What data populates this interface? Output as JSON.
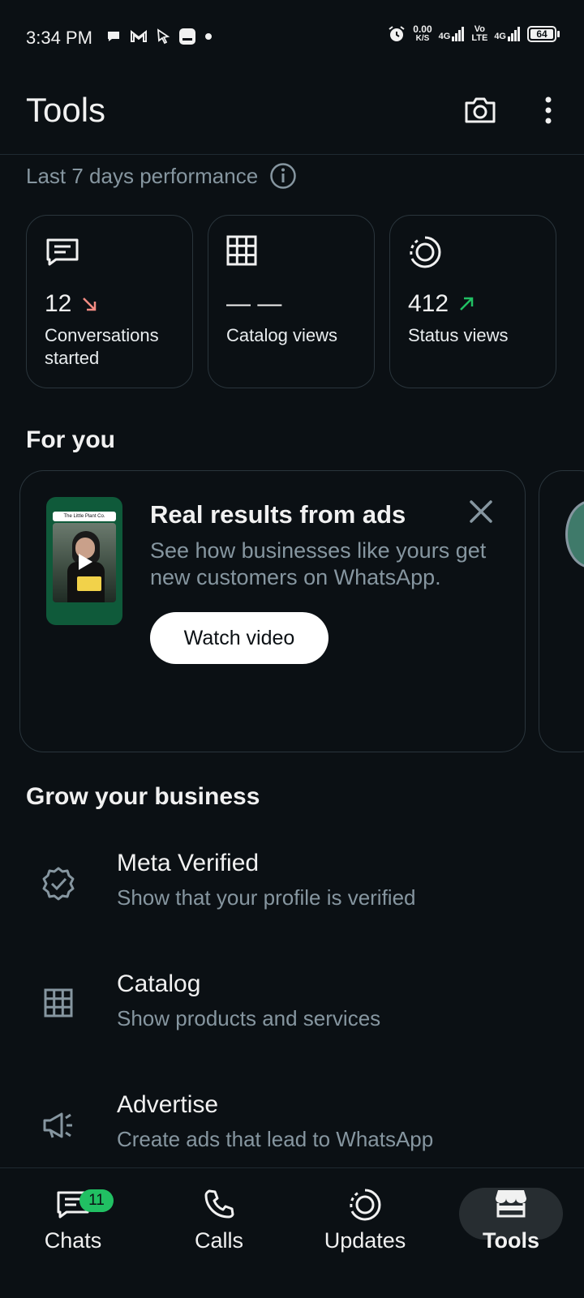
{
  "status_bar": {
    "time": "3:34 PM",
    "net_speed_value": "0.00",
    "net_speed_unit": "K/S",
    "sim1_tag": "4G",
    "volte_top": "Vo",
    "volte_bottom": "LTE",
    "sim2_tag": "4G",
    "battery": "64",
    "icons": [
      "chat-notification-icon",
      "gmail-icon",
      "cursor-icon",
      "app-notification-icon",
      "dot-icon",
      "alarm-icon",
      "signal-icon",
      "battery-icon"
    ]
  },
  "header": {
    "title": "Tools",
    "icons": [
      "camera-icon",
      "more-options-icon"
    ]
  },
  "performance": {
    "title": "Last 7 days performance",
    "cards": [
      {
        "icon": "chat-icon",
        "value": "12",
        "trend": "down",
        "label": "Conversations started"
      },
      {
        "icon": "catalog-grid-icon",
        "value": "— —",
        "trend": "none",
        "label": "Catalog views"
      },
      {
        "icon": "status-icon",
        "value": "412",
        "trend": "up",
        "label": "Status views"
      }
    ]
  },
  "for_you": {
    "title": "For you",
    "promo": {
      "thumb_caption": "The Little Plant Co.",
      "title": "Real results from ads",
      "description": "See how businesses like yours get new customers on WhatsApp.",
      "button": "Watch video"
    }
  },
  "grow": {
    "title": "Grow your business",
    "items": [
      {
        "icon": "verified-badge-icon",
        "title": "Meta Verified",
        "subtitle": "Show that your profile is verified"
      },
      {
        "icon": "catalog-grid-icon",
        "title": "Catalog",
        "subtitle": "Show products and services"
      },
      {
        "icon": "megaphone-icon",
        "title": "Advertise",
        "subtitle": "Create ads that lead to WhatsApp"
      }
    ]
  },
  "bottom_nav": {
    "items": [
      {
        "icon": "chats-icon",
        "label": "Chats",
        "badge": "11"
      },
      {
        "icon": "calls-icon",
        "label": "Calls"
      },
      {
        "icon": "updates-icon",
        "label": "Updates"
      },
      {
        "icon": "tools-store-icon",
        "label": "Tools",
        "active": true
      }
    ]
  },
  "colors": {
    "background": "#0b1014",
    "accent_green": "#21c063",
    "trend_down": "#f28b82",
    "trend_up": "#21c063",
    "muted_text": "#8696a0"
  }
}
